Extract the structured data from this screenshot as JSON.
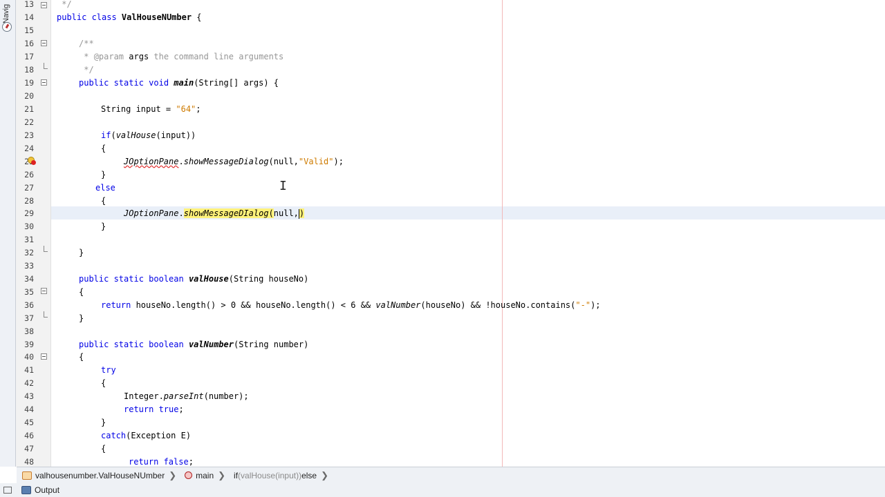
{
  "navigator": {
    "tab_label": "Navig"
  },
  "editor": {
    "lines": [
      {
        "num": "13",
        "y": 0
      },
      {
        "num": "14",
        "y": 0
      },
      {
        "num": "15",
        "y": 0
      },
      {
        "num": "16",
        "y": 0
      },
      {
        "num": "17",
        "y": 0
      },
      {
        "num": "18",
        "y": 0
      },
      {
        "num": "19",
        "y": 0
      },
      {
        "num": "20",
        "y": 0
      },
      {
        "num": "21",
        "y": 0
      },
      {
        "num": "22",
        "y": 0
      },
      {
        "num": "23",
        "y": 0
      },
      {
        "num": "24",
        "y": 0
      },
      {
        "num": "25",
        "y": 0
      },
      {
        "num": "26",
        "y": 0
      },
      {
        "num": "27",
        "y": 0
      },
      {
        "num": "28",
        "y": 0
      },
      {
        "num": "29",
        "y": 0
      },
      {
        "num": "30",
        "y": 0
      },
      {
        "num": "31",
        "y": 0
      },
      {
        "num": "32",
        "y": 0
      },
      {
        "num": "33",
        "y": 0
      },
      {
        "num": "34",
        "y": 0
      },
      {
        "num": "35",
        "y": 0
      },
      {
        "num": "36",
        "y": 0
      },
      {
        "num": "37",
        "y": 0
      },
      {
        "num": "38",
        "y": 0
      },
      {
        "num": "39",
        "y": 0
      },
      {
        "num": "40",
        "y": 0
      },
      {
        "num": "41",
        "y": 0
      },
      {
        "num": "42",
        "y": 0
      },
      {
        "num": "43",
        "y": 0
      },
      {
        "num": "44",
        "y": 0
      },
      {
        "num": "45",
        "y": 0
      },
      {
        "num": "46",
        "y": 0
      },
      {
        "num": "47",
        "y": 0
      },
      {
        "num": "48",
        "y": 0
      }
    ],
    "code": {
      "l13_comment": " */",
      "l14_kw": "public class ",
      "l14_name": "ValHouseNUmber",
      "l14_rest": " {",
      "l16_comment": "/**",
      "l17_star": " * ",
      "l17_tag": "@param",
      "l17_arg": " args",
      "l17_text": " the command line arguments",
      "l18_comment": " */",
      "l19_kw": "public static void ",
      "l19_name": "main",
      "l19_rest": "(String[] args) {",
      "l21_text": "String input = ",
      "l21_str": "\"64\"",
      "l21_end": ";",
      "l23_kw": "if",
      "l23_a": "(",
      "l23_call": "valHouse",
      "l23_b": "(input))",
      "l24_text": "{",
      "l25_class": "JOptionPane",
      "l25_dot": ".",
      "l25_method": "showMessageDialog",
      "l25_a": "(null,",
      "l25_str": "\"Valid\"",
      "l25_end": ");",
      "l26_text": "}",
      "l27_kw": "else",
      "l28_text": "{",
      "l29_class": "JOptionPane",
      "l29_dot": ".",
      "l29_method": "showMessageDIalog",
      "l29_paren": "(",
      "l29_args": "null,",
      "l29_close": ")",
      "l30_text": "}",
      "l32_text": "}",
      "l34_kw": "public static boolean ",
      "l34_name": "valHouse",
      "l34_rest": "(String houseNo)",
      "l35_text": "{",
      "l36_kw": "return",
      "l36_a": " houseNo.length() > 0 && houseNo.length() < 6 && ",
      "l36_call": "valNumber",
      "l36_b": "(houseNo) && !houseNo.contains(",
      "l36_str": "\"-\"",
      "l36_end": ");",
      "l37_text": "}",
      "l39_kw": "public static boolean ",
      "l39_name": "valNumber",
      "l39_rest": "(String number)",
      "l40_text": "{",
      "l41_kw": "try",
      "l42_text": "{",
      "l43_a": "Integer.",
      "l43_call": "parseInt",
      "l43_b": "(number);",
      "l44_kw": "return",
      "l44_kw2": " true",
      "l44_end": ";",
      "l45_text": "}",
      "l46_kw": "catch",
      "l46_rest": "(Exception E)",
      "l47_text": "{",
      "l48_kw": "return",
      "l48_kw2": " false",
      "l48_end": ";"
    }
  },
  "breadcrumb": {
    "class_label": "valhousenumber.ValHouseNUmber",
    "method_label": "main",
    "stmt_kw": "if",
    "stmt_cond": " (valHouse(input))",
    "stmt_else": " else"
  },
  "output": {
    "label": "Output"
  }
}
